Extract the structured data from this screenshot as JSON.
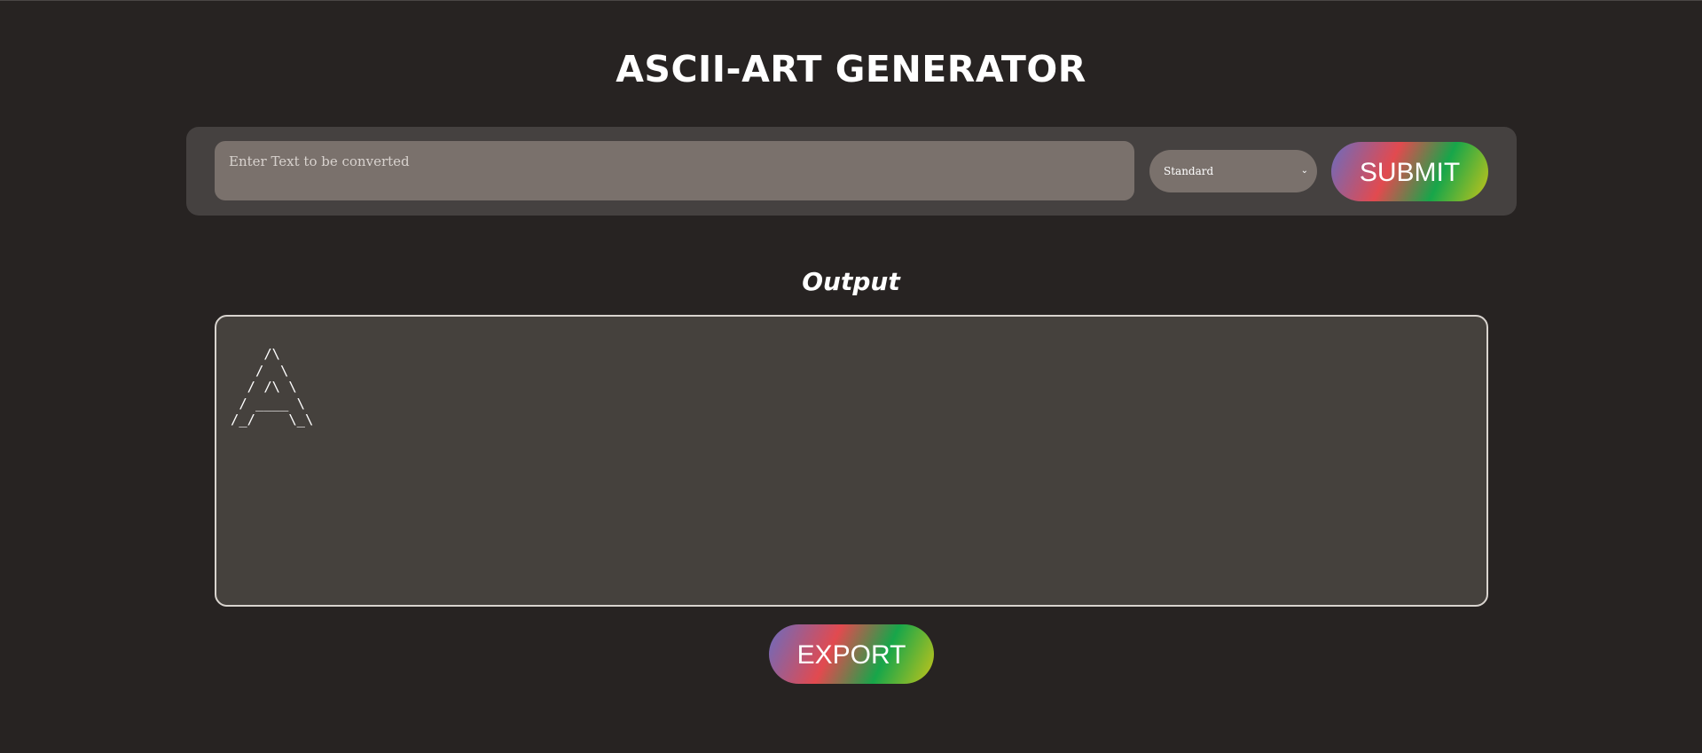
{
  "header": {
    "title": "ASCII-ART GENERATOR"
  },
  "form": {
    "text_input": {
      "value": "",
      "placeholder": "Enter Text to be converted"
    },
    "font_select": {
      "selected": "Standard",
      "icon": "chevron-down-icon"
    },
    "submit_label": "SUBMIT"
  },
  "output": {
    "title": "Output",
    "ascii_art": "    /\\\n   /  \\\n  / /\\ \\\n / ____ \\\n/_/    \\_\\"
  },
  "export_label": "EXPORT",
  "colors": {
    "background": "#272322",
    "panel": "#454140",
    "input": "#7a716c",
    "gradient": [
      "#6a6cc0",
      "#e24a4f",
      "#17a64a",
      "#c6c41a"
    ]
  }
}
